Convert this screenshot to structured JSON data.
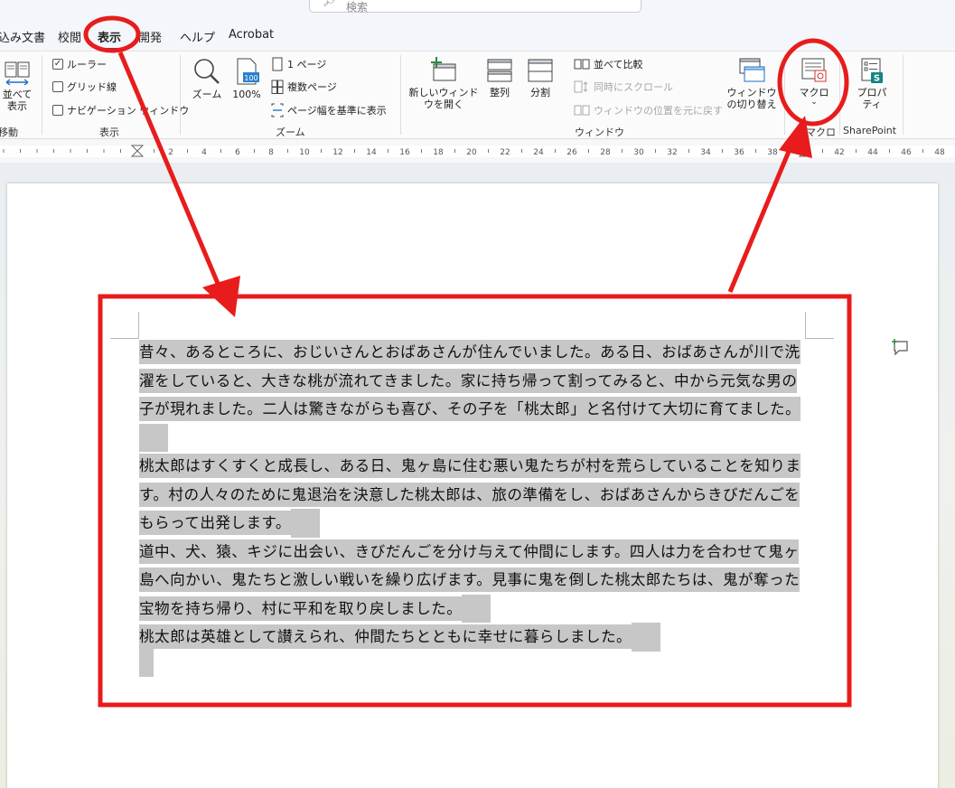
{
  "search": {
    "placeholder": "検索"
  },
  "tabs": [
    {
      "label": "込み文書"
    },
    {
      "label": "校閲"
    },
    {
      "label": "表示"
    },
    {
      "label": "開発"
    },
    {
      "label": "ヘルプ"
    },
    {
      "label": "Acrobat"
    }
  ],
  "ribbon": {
    "move_group": {
      "button": "並べて表示",
      "label": "移動"
    },
    "show_group": {
      "label": "表示",
      "items": [
        {
          "label": "ルーラー",
          "checked": "✓"
        },
        {
          "label": "グリッド線",
          "checked": ""
        },
        {
          "label": "ナビゲーション ウィンドウ",
          "checked": ""
        }
      ]
    },
    "zoom_group": {
      "label": "ズーム",
      "zoom": "ズーム",
      "zoom100": "100%",
      "icon100": "100",
      "one_page": "1 ページ",
      "multi_page": "複数ページ",
      "page_width": "ページ幅を基準に表示"
    },
    "window_group": {
      "label": "ウィンドウ",
      "new_window": "新しいウィンドウを開く",
      "arrange": "整列",
      "split": "分割",
      "side_by_side": "並べて比較",
      "sync_scroll": "同時にスクロール",
      "reset_position": "ウィンドウの位置を元に戻す",
      "switch_window": "ウィンドウの切り替え"
    },
    "macro_group": {
      "label": "マクロ",
      "button": "マクロ"
    },
    "sharepoint_group": {
      "label": "SharePoint",
      "button": "プロパティ"
    }
  },
  "document": {
    "paragraphs": [
      "昔々、あるところに、おじいさんとおばあさんが住んでいました。ある日、おばあさんが川で洗濯をしていると、大きな桃が流れてきました。家に持ち帰って割ってみると、中から元気な男の子が現れました。二人は驚きながらも喜び、その子を「桃太郎」と名付けて大切に育てました。",
      "桃太郎はすくすくと成長し、ある日、鬼ヶ島に住む悪い鬼たちが村を荒らしていることを知ります。村の人々のために鬼退治を決意した桃太郎は、旅の準備をし、おばあさんからきびだんごをもらって出発します。",
      "道中、犬、猿、キジに出会い、きびだんごを分け与えて仲間にします。四人は力を合わせて鬼ヶ島へ向かい、鬼たちと激しい戦いを繰り広げます。見事に鬼を倒した桃太郎たちは、鬼が奪った宝物を持ち帰り、村に平和を取り戻しました。",
      "桃太郎は英雄として讃えられ、仲間たちとともに幸せに暮らしました。"
    ]
  },
  "colors": {
    "annotation_red": "#e81c1c",
    "selection_gray": "#c7c7c7",
    "active_tab_underline": "#1a56b4"
  }
}
